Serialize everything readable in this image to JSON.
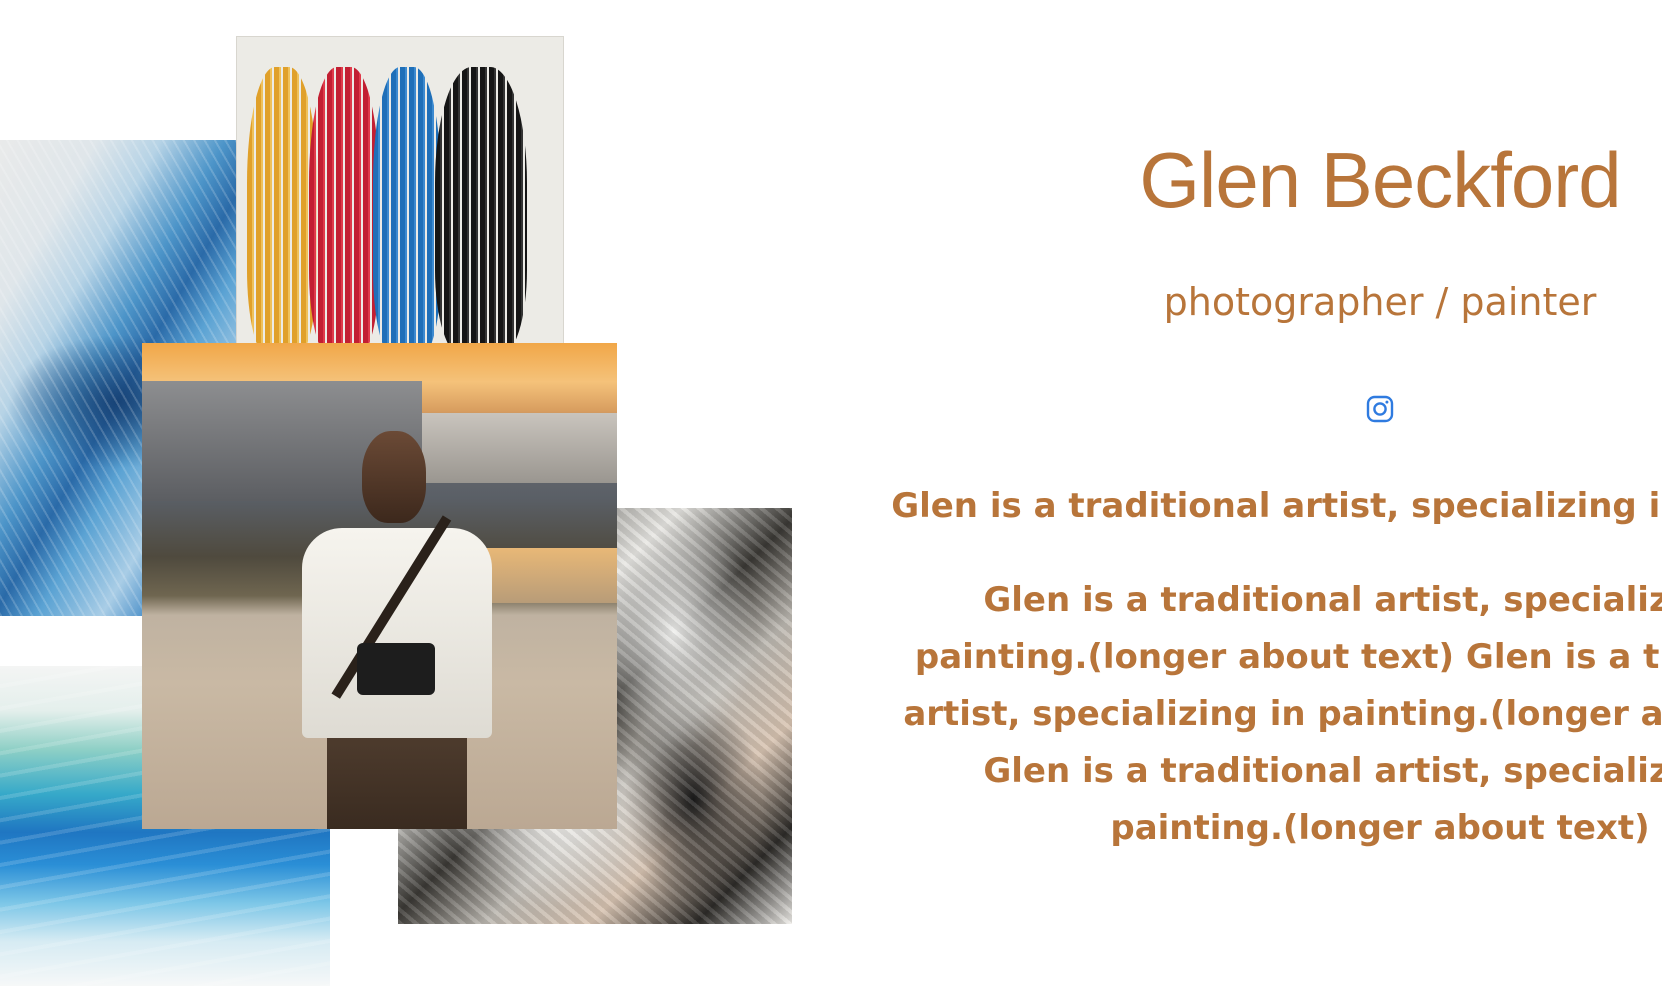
{
  "profile": {
    "name": "Glen Beckford",
    "role": "photographer / painter",
    "instagram_icon": "instagram-icon",
    "about_short": "Glen is a traditional artist, specializing in painting.",
    "about_long": "Glen is a traditional artist, specializing in painting.(longer about text) Glen is a traditional artist, specializing in painting.(longer about text) Glen is a traditional artist, specializing in painting.(longer about text)"
  },
  "colors": {
    "accent": "#b8753a",
    "link": "#2f7be0",
    "background": "#ffffff"
  },
  "gallery": {
    "images": [
      "blue-texture-painting",
      "color-stripes-painting",
      "portrait-photo",
      "black-white-marble-painting",
      "blue-watercolor-painting"
    ]
  }
}
